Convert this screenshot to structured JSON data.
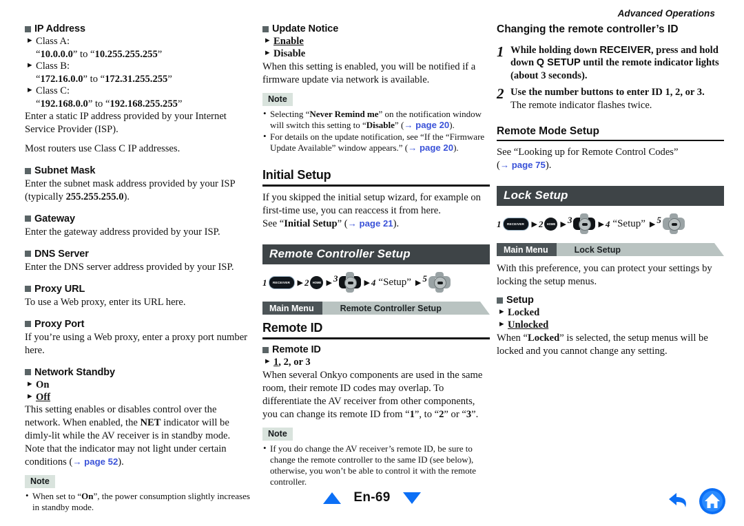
{
  "page": {
    "running_head": "Advanced Operations",
    "page_number": "En-69"
  },
  "left_column": {
    "ip_address": {
      "title": "IP Address",
      "options": [
        {
          "label": "Class A:",
          "value_prefix": "“",
          "value_a": "10.0.0.0",
          "mid": "” to “",
          "value_b": "10.255.255.255",
          "value_suffix": "”"
        },
        {
          "label": "Class B:",
          "value_prefix": "“",
          "value_a": "172.16.0.0",
          "mid": "” to “",
          "value_b": "172.31.255.255",
          "value_suffix": "”"
        },
        {
          "label": "Class C:",
          "value_prefix": "“",
          "value_a": "192.168.0.0",
          "mid": "” to “",
          "value_b": "192.168.255.255",
          "value_suffix": "”"
        }
      ],
      "para1": "Enter a static IP address provided by your Internet Service Provider (ISP).",
      "para2": "Most routers use Class C IP addresses."
    },
    "subnet_mask": {
      "title": "Subnet Mask",
      "text_before": "Enter the subnet mask address provided by your ISP (typically ",
      "value": "255.255.255.0",
      "text_after": ")."
    },
    "gateway": {
      "title": "Gateway",
      "text": "Enter the gateway address provided by your ISP."
    },
    "dns_server": {
      "title": "DNS Server",
      "text": "Enter the DNS server address provided by your ISP."
    },
    "proxy_url": {
      "title": "Proxy URL",
      "text": "To use a Web proxy, enter its URL here."
    },
    "proxy_port": {
      "title": "Proxy Port",
      "text": "If you’re using a Web proxy, enter a proxy port number here."
    },
    "network_standby": {
      "title": "Network Standby",
      "option_on": "On",
      "option_off": "Off",
      "text_1": "This setting enables or disables control over the network. When enabled, the ",
      "net_word": "NET",
      "text_2": " indicator will be dimly-lit while the AV receiver is in standby mode. Note that the indicator may not light under certain conditions (",
      "link": "→ page 52",
      "text_3": ").",
      "note_badge": "Note",
      "note_items": [
        {
          "pre": "When set to “",
          "bold": "On",
          "post": "”, the power consumption slightly increases in standby mode."
        }
      ]
    }
  },
  "mid_column": {
    "update_notice": {
      "title": "Update Notice",
      "option_enable": "Enable",
      "option_disable": "Disable",
      "text": "When this setting is enabled, you will be notified if a firmware update via network is available.",
      "note_badge": "Note",
      "note_items": [
        {
          "pre": "Selecting “",
          "bold1": "Never Remind me",
          "mid": "” on the notification window will switch this setting to “",
          "bold2": "Disable",
          "post": "” (",
          "link": "→ page 20",
          "tail": ")."
        },
        {
          "pre": "For details on the update notification, see “If the “Firmware Update Available” window appears.” (",
          "link": "→ page 20",
          "tail": ")."
        }
      ]
    },
    "initial_setup": {
      "heading": "Initial Setup",
      "para": "If you skipped the initial setup wizard, for example on first-time use, you can reaccess it from here.",
      "see_pre": "See “",
      "see_bold": "Initial Setup",
      "see_mid": "” (",
      "see_link": "→ page 21",
      "see_tail": ")."
    },
    "remote_controller_setup": {
      "title_bar": "Remote Controller Setup",
      "sequence": [
        {
          "num": "1",
          "icon": "receiver-button-icon",
          "label": "RECEIVER"
        },
        {
          "num": "2",
          "icon": "home-button-icon",
          "label": "HOME"
        },
        {
          "num": "3",
          "icon": "dpad-left-right-icon",
          "label": ""
        },
        {
          "num": "4",
          "icon": "text-label",
          "label": "“Setup”"
        },
        {
          "num": "5",
          "icon": "dpad-enter-icon",
          "label": ""
        }
      ],
      "breadcrumb_root": "Main Menu",
      "breadcrumb_current": "Remote Controller Setup"
    },
    "remote_id_section": {
      "heading": "Remote ID",
      "subhead": "Remote ID",
      "option_line": {
        "first": "1",
        "rest": ", 2, or 3"
      },
      "para_1": "When several Onkyo components are used in the same room, their remote ID codes may overlap. To differentiate the AV receiver from other components, you can change its remote ID from “",
      "b1": "1",
      "para_2": "”, to “",
      "b2": "2",
      "para_3": "” or “",
      "b3": "3",
      "para_4": "”.",
      "note_badge": "Note",
      "note_items": [
        {
          "text": "If you do change the AV receiver’s remote ID, be sure to change the remote controller to the same ID (see below), otherwise, you won’t be able to control it with the remote controller."
        }
      ]
    }
  },
  "right_column": {
    "changing_id": {
      "heading": "Changing the remote controller’s ID",
      "steps": [
        {
          "num": "1",
          "lead_pre": "While holding down ",
          "lead_b1": "RECEIVER",
          "lead_mid": ", press and hold down ",
          "lead_b2": "Q SETUP",
          "lead_post": " until the remote indicator lights (about 3 seconds).",
          "sub": ""
        },
        {
          "num": "2",
          "lead_pre": "Use the number buttons to enter ID 1, 2, or 3.",
          "lead_b1": "",
          "lead_mid": "",
          "lead_b2": "",
          "lead_post": "",
          "sub": "The remote indicator flashes twice."
        }
      ]
    },
    "remote_mode_setup": {
      "heading": "Remote Mode Setup",
      "text": "See “Looking up for Remote Control Codes”",
      "link_pre": "(",
      "link": "→ page 75",
      "link_post": ")."
    },
    "lock_setup": {
      "title_bar": "Lock Setup",
      "sequence": [
        {
          "num": "1",
          "icon": "receiver-button-icon",
          "label": "RECEIVER"
        },
        {
          "num": "2",
          "icon": "home-button-icon",
          "label": "HOME"
        },
        {
          "num": "3",
          "icon": "dpad-left-right-icon",
          "label": ""
        },
        {
          "num": "4",
          "icon": "text-label",
          "label": "“Setup”"
        },
        {
          "num": "5",
          "icon": "dpad-enter-icon",
          "label": ""
        }
      ],
      "breadcrumb_root": "Main Menu",
      "breadcrumb_current": "Lock Setup",
      "para": "With this preference, you can protect your settings by locking the setup menus.",
      "subhead": "Setup",
      "option_locked": "Locked",
      "option_unlocked": "Unlocked",
      "closing_pre": "When “",
      "closing_b": "Locked",
      "closing_post": "” is selected, the setup menus will be locked and you cannot change any setting."
    }
  },
  "footer": {
    "page_label": "En-69",
    "up_icon": "triangle-up-icon",
    "down_icon": "triangle-down-icon",
    "back_icon": "back-arrow-icon",
    "home_icon": "home-circle-icon"
  },
  "colors": {
    "title_bar": "#3e4447",
    "breadcrumb_dark": "#4c5457",
    "breadcrumb_light": "#b9c3c1",
    "note_badge": "#d9e3dd",
    "link_blue": "#3a52d8",
    "nav_blue": "#0c6ff5",
    "bullet_square": "#5a6466"
  }
}
